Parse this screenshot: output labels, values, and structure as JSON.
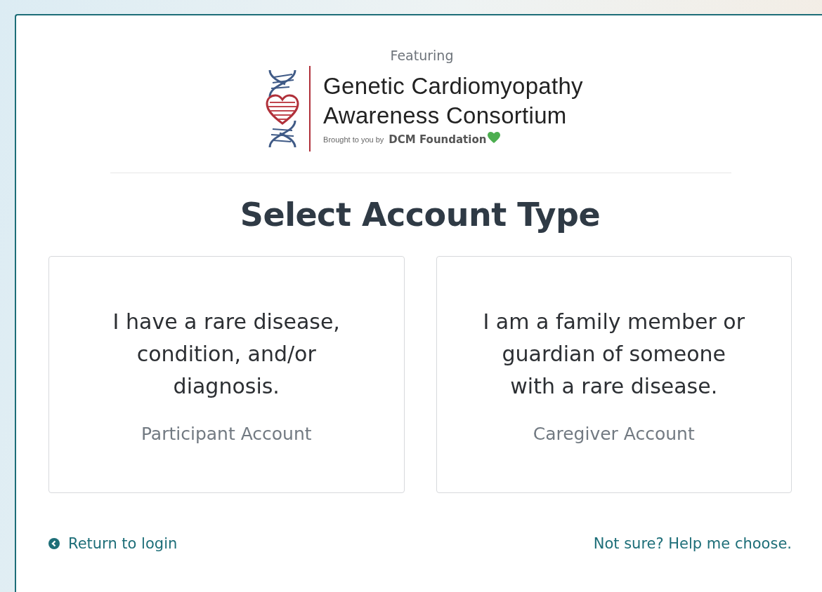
{
  "featuring": "Featuring",
  "logo": {
    "title_lines": [
      "Genetic Cardiomyopathy",
      "Awareness Consortium"
    ],
    "tagline": "Brought to you by",
    "foundation": "DCM Foundation"
  },
  "heading": "Select Account Type",
  "account_options": [
    {
      "statement": "I have a rare disease, condition, and/or diagnosis.",
      "account_label": "Participant Account"
    },
    {
      "statement": "I am a family member or guardian of someone with a rare disease.",
      "account_label": "Caregiver Account"
    }
  ],
  "footer": {
    "back_link": "Return to login",
    "help_link": "Not sure? Help me choose."
  }
}
